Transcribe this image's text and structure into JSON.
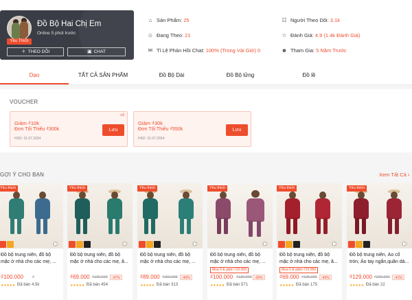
{
  "shop": {
    "name": "Đồ Bộ Hai Chị Em",
    "online": "Online 5 phút trước",
    "badge": "Yêu Thích",
    "follow_label": "THEO DÕI",
    "chat_label": "CHAT"
  },
  "stats": [
    {
      "icon": "shop-icon",
      "glyph": "⌂",
      "label": "Sản Phẩm:",
      "value": "25"
    },
    {
      "icon": "people-icon",
      "glyph": "☺",
      "label": "Đang Theo:",
      "value": "21"
    },
    {
      "icon": "chat-bubble-icon",
      "glyph": "✉",
      "label": "Tỉ Lệ Phản Hồi Chat:",
      "value": "100% (Trong Vài Giờ)",
      "value2": "0"
    },
    {
      "icon": "followers-icon",
      "glyph": "☷",
      "label": "Người Theo Dõi:",
      "value": "3.1k"
    },
    {
      "icon": "star-icon",
      "glyph": "☆",
      "label": "Đánh Giá:",
      "value": "4.9 (1.4k Đánh Giá)"
    },
    {
      "icon": "user-join-icon",
      "glyph": "☻",
      "label": "Tham Gia:",
      "value": "5 Năm Trước"
    }
  ],
  "tabs": [
    "Dạo",
    "TẤT CẢ SẢN PHẨM",
    "Đồ Bộ Dài",
    "Đồ Bộ lửng",
    "Đồ lề"
  ],
  "voucher": {
    "title": "VOUCHER",
    "cards": [
      {
        "discount": "Giảm ₫10k",
        "min": "Đơn Tối Thiểu ₫300k",
        "expiry": "HSD: 31.07.2024",
        "save_label": "Lưu",
        "qty": "x3"
      },
      {
        "discount": "Giảm ₫30k",
        "min": "Đơn Tối Thiểu ₫550k",
        "expiry": "HSD: 31.07.2024",
        "save_label": "Lưu",
        "qty": ""
      }
    ]
  },
  "recommend": {
    "title": "GỢI Ý CHO BẠN",
    "see_all": "Xem Tất Cả",
    "products": [
      {
        "fav": "Yêu thích",
        "name": "Đồ bộ trung niên, đồ bộ mặc ở nhà cho các mẹ, ...",
        "promo": "",
        "price": "₫100.000",
        "old": "₫",
        "disc": "",
        "stars": "★★★★★",
        "sold": "Đã bán 4.5k"
      },
      {
        "fav": "Yêu thích",
        "name": "Đồ bộ trung niên, đồ bộ mặc ở nhà cho các mẹ, â...",
        "promo": "",
        "price": "₫69.000",
        "old": "₫130.000",
        "disc": "-47%",
        "stars": "★★★★★",
        "sold": "Đã bán 454"
      },
      {
        "fav": "Yêu thích",
        "name": "Đồ bộ trung niên, đồ bộ mặc ở nhà cho các mẹ, ...",
        "promo": "",
        "price": "₫89.000",
        "old": "₫150.000",
        "disc": "-40%",
        "stars": "★★★★★",
        "sold": "Đã bán 313"
      },
      {
        "fav": "Yêu thích",
        "name": "Đồ bộ trung niên, đồ bộ mặc ở nhà cho các mẹ, ...",
        "promo": "Mua 5 & giảm ₫10.000",
        "price": "₫100.000",
        "old": "₫130.000",
        "disc": "-30%",
        "stars": "★★★★★",
        "sold": "Đã bán 571"
      },
      {
        "fav": "Yêu thích",
        "name": "Đồ bộ trung niên, đồ bộ mặc ở nhà cho các mẹ, â...",
        "promo": "Mua 5 & giảm ₫10.000",
        "price": "₫69.000",
        "old": "₫125.000",
        "disc": "-45%",
        "stars": "★★★★★",
        "sold": "Đã bán 175"
      },
      {
        "fav": "Yêu thích",
        "name": "Đồ bộ trung niên, Áo cổ tròn, Áo tay ngắn,quần dà...",
        "promo": "",
        "price": "₫129.000",
        "old": "₫220.000",
        "disc": "-41%",
        "stars": "★★★★★",
        "sold": "Đã bán 22"
      }
    ]
  },
  "colors": {
    "accent": "#ee4d2d",
    "header_card": "#3a3d45"
  }
}
